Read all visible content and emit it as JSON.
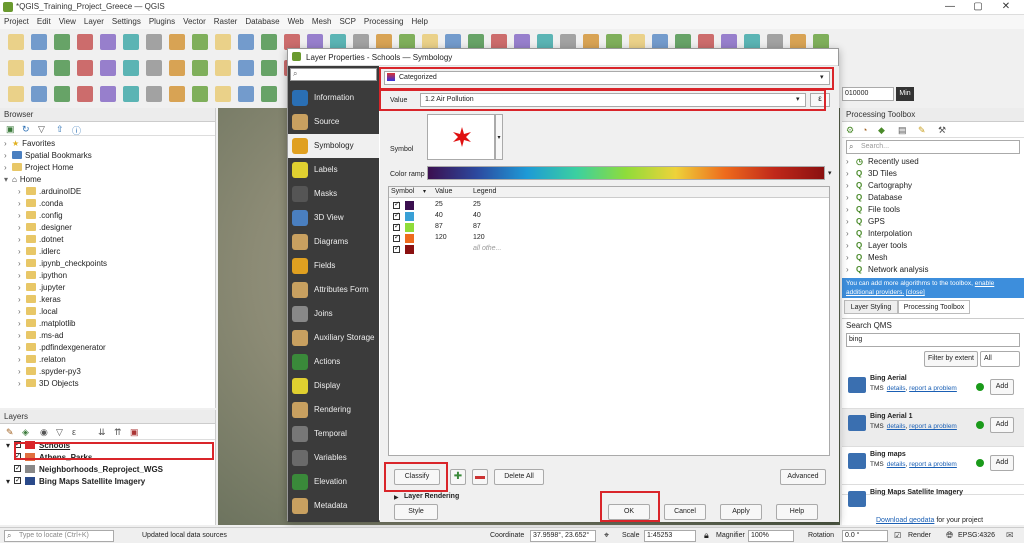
{
  "window": {
    "title": "*QGIS_Training_Project_Greece — QGIS",
    "minimize": "—",
    "maximize": "▢",
    "close": "✕"
  },
  "menu": [
    "Project",
    "Edit",
    "View",
    "Layer",
    "Settings",
    "Plugins",
    "Vector",
    "Raster",
    "Database",
    "Web",
    "Mesh",
    "SCP",
    "Processing",
    "Help"
  ],
  "browser": {
    "title": "Browser",
    "items": [
      {
        "label": "Favorites",
        "type": "star"
      },
      {
        "label": "Spatial Bookmarks",
        "type": "bookmark"
      },
      {
        "label": "Project Home",
        "type": "folder"
      },
      {
        "label": "Home",
        "type": "home"
      },
      {
        "label": ".arduinoIDE",
        "type": "folder"
      },
      {
        "label": ".conda",
        "type": "folder"
      },
      {
        "label": ".config",
        "type": "folder"
      },
      {
        "label": ".designer",
        "type": "folder"
      },
      {
        "label": ".dotnet",
        "type": "folder"
      },
      {
        "label": ".idlerc",
        "type": "folder"
      },
      {
        "label": ".ipynb_checkpoints",
        "type": "folder"
      },
      {
        "label": ".ipython",
        "type": "folder"
      },
      {
        "label": ".jupyter",
        "type": "folder"
      },
      {
        "label": ".keras",
        "type": "folder"
      },
      {
        "label": ".local",
        "type": "folder"
      },
      {
        "label": ".matplotlib",
        "type": "folder"
      },
      {
        "label": ".ms-ad",
        "type": "folder"
      },
      {
        "label": ".pdfindexgenerator",
        "type": "folder"
      },
      {
        "label": ".relaton",
        "type": "folder"
      },
      {
        "label": ".spyder-py3",
        "type": "folder"
      },
      {
        "label": "3D Objects",
        "type": "folder"
      }
    ]
  },
  "layers": {
    "title": "Layers",
    "items": [
      {
        "label": "Schools",
        "color": "#d9252a"
      },
      {
        "label": "Athens_Parks",
        "color": "#e07040"
      },
      {
        "label": "Neighborhoods_Reproject_WGS",
        "color": "#888888"
      },
      {
        "label": "Bing Maps Satellite Imagery",
        "color": "#2a4a8a"
      }
    ]
  },
  "dialog": {
    "title": "Layer Properties - Schools — Symbology",
    "search_placeholder": "",
    "nav": [
      "Information",
      "Source",
      "Symbology",
      "Labels",
      "Masks",
      "3D View",
      "Diagrams",
      "Fields",
      "Attributes Form",
      "Joins",
      "Auxiliary Storage",
      "Actions",
      "Display",
      "Rendering",
      "Temporal",
      "Variables",
      "Elevation",
      "Metadata"
    ],
    "renderer": "Categorized",
    "value_label": "Value",
    "value_field": "1.2 Air Pollution",
    "symbol_label": "Symbol",
    "color_ramp_label": "Color ramp",
    "table_headers": [
      "Symbol",
      "Value",
      "Legend"
    ],
    "rows": [
      {
        "value": "25",
        "legend": "25",
        "color": "#3b0f4f"
      },
      {
        "value": "40",
        "legend": "40",
        "color": "#39a0d6"
      },
      {
        "value": "87",
        "legend": "87",
        "color": "#8fdc3a"
      },
      {
        "value": "120",
        "legend": "120",
        "color": "#ee6b1d"
      },
      {
        "value": "",
        "legend": "all othe...",
        "color": "#8a1010"
      }
    ],
    "classify": "Classify",
    "delete_all": "Delete All",
    "advanced": "Advanced",
    "layer_rendering": "Layer Rendering",
    "style": "Style",
    "ok": "OK",
    "cancel": "Cancel",
    "apply": "Apply",
    "help": "Help"
  },
  "processing": {
    "title": "Processing Toolbox",
    "search_placeholder": "Search...",
    "items": [
      "Recently used",
      "3D Tiles",
      "Cartography",
      "Database",
      "File tools",
      "GPS",
      "Interpolation",
      "Layer tools",
      "Mesh",
      "Network analysis"
    ],
    "info_text": "You can add more algorithms to the toolbox,",
    "info_link": "enable additional providers.",
    "info_close": "[close]",
    "tabs": [
      "Layer Styling",
      "Processing Toolbox"
    ]
  },
  "qms": {
    "title": "Search QMS",
    "query": "bing",
    "filter_button": "Filter by extent",
    "filter_select": "All",
    "results": [
      {
        "name": "Bing Aerial",
        "type": "TMS"
      },
      {
        "name": "Bing Aerial 1",
        "type": "TMS"
      },
      {
        "name": "Bing maps",
        "type": "TMS"
      },
      {
        "name": "Bing Maps Satellite Imagery",
        "type": ""
      }
    ],
    "details": "details",
    "report": "report a problem",
    "add": "Add",
    "download_link": "Download geodata",
    "download_suffix": "for your project"
  },
  "toolbar": {
    "scale_value": "010000",
    "min_label": "Min"
  },
  "status": {
    "locate_placeholder": "Type to locate (Ctrl+K)",
    "message": "Updated local data sources",
    "coordinate_label": "Coordinate",
    "coordinate": "37.9598°, 23.652°",
    "scale_label": "Scale",
    "scale": "1:45253",
    "magnifier_label": "Magnifier",
    "magnifier": "100%",
    "rotation_label": "Rotation",
    "rotation": "0.0 °",
    "render_label": "Render",
    "crs": "EPSG:4326"
  },
  "colors": {
    "highlight": "#d9252a",
    "accent": "#1a5fb4",
    "nav_bg": "#3b3b3b"
  }
}
